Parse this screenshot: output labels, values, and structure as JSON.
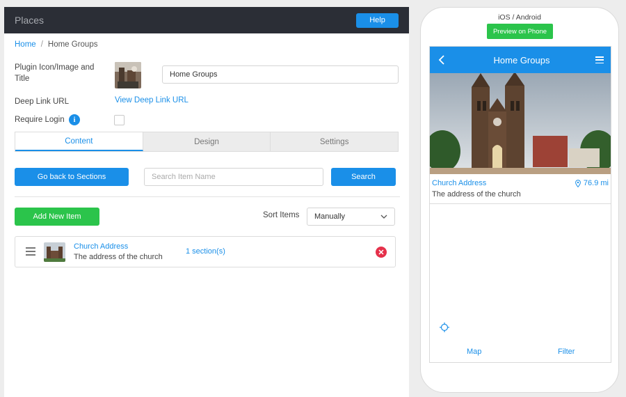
{
  "header": {
    "title": "Places",
    "help_label": "Help"
  },
  "breadcrumb": {
    "home": "Home",
    "separator": "/",
    "current": "Home Groups"
  },
  "form": {
    "plugin_label": "Plugin Icon/Image and Title",
    "title_value": "Home Groups",
    "deep_link_label": "Deep Link URL",
    "deep_link_text": "View Deep Link URL",
    "require_login_label": "Require Login",
    "info_icon_glyph": "i"
  },
  "tabs": [
    {
      "label": "Content",
      "active": true
    },
    {
      "label": "Design",
      "active": false
    },
    {
      "label": "Settings",
      "active": false
    }
  ],
  "toolbar": {
    "back_label": "Go back to Sections",
    "search_placeholder": "Search Item Name",
    "search_label": "Search",
    "add_label": "Add New Item",
    "sort_label": "Sort Items",
    "sort_value": "Manually"
  },
  "items": [
    {
      "title": "Church Address",
      "subtitle": "The address of the church",
      "sections": "1 section(s)"
    }
  ],
  "phone": {
    "platform": "iOS / Android",
    "preview_label": "Preview on Phone",
    "app_title": "Home Groups",
    "place_title": "Church Address",
    "place_distance": "76.9 mi",
    "place_address": "The address of the church",
    "nav_map": "Map",
    "nav_filter": "Filter"
  },
  "colors": {
    "accent": "#1a8fe8",
    "success": "#2bc44b",
    "danger": "#e5304a",
    "header_bg": "#2b2e36"
  },
  "icons": [
    "back-arrow-icon",
    "menu-icon",
    "location-pin-icon",
    "crosshair-icon",
    "drag-handle-icon",
    "delete-icon",
    "info-icon",
    "chevron-down-icon"
  ]
}
